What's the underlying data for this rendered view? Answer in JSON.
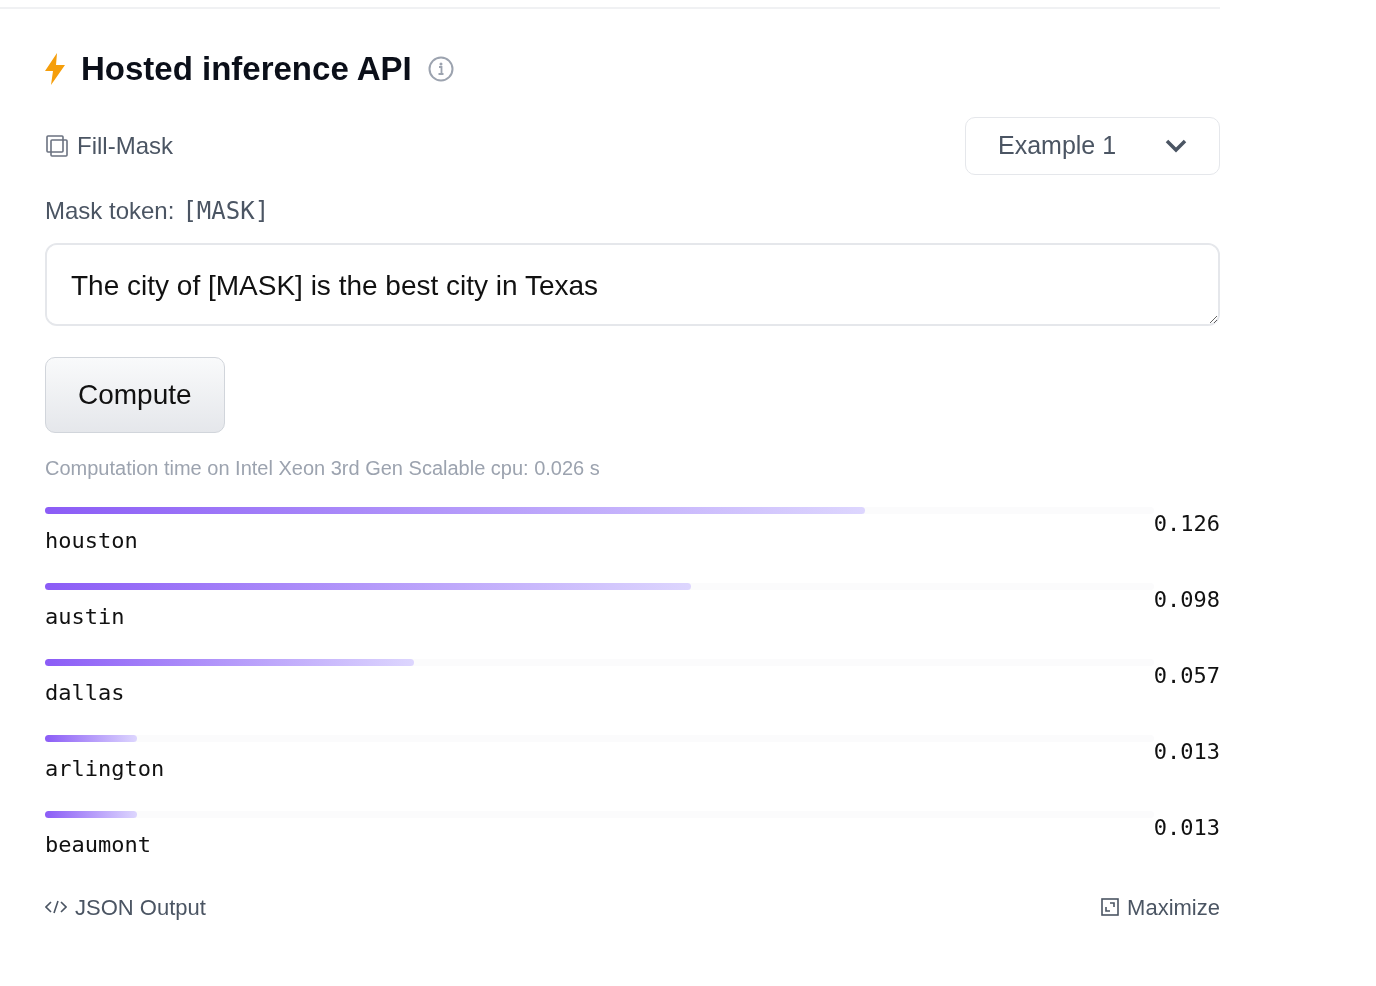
{
  "header": {
    "title": "Hosted inference API"
  },
  "task": {
    "label": "Fill-Mask"
  },
  "example_select": {
    "value": "Example 1"
  },
  "mask_token": {
    "label": "Mask token:",
    "token": "[MASK]"
  },
  "input": {
    "value": "The city of [MASK] is the best city in Texas"
  },
  "compute_button": {
    "label": "Compute"
  },
  "computation_time": "Computation time on Intel Xeon 3rd Gen Scalable cpu: 0.026 s",
  "results": [
    {
      "label": "houston",
      "score": "0.126",
      "level": 0.74
    },
    {
      "label": "austin",
      "score": "0.098",
      "level": 0.583
    },
    {
      "label": "dallas",
      "score": "0.057",
      "level": 0.333
    },
    {
      "label": "arlington",
      "score": "0.013",
      "level": 0.083
    },
    {
      "label": "beaumont",
      "score": "0.013",
      "level": 0.083
    }
  ],
  "footer": {
    "json_output": "JSON Output",
    "maximize": "Maximize"
  }
}
